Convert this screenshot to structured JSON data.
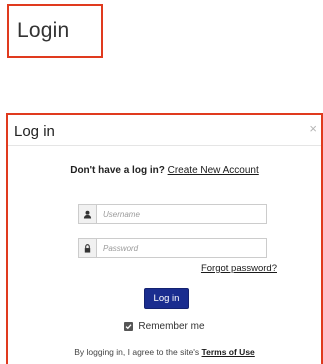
{
  "top_link": {
    "label": "Login"
  },
  "modal": {
    "title": "Log in",
    "close_glyph": "×",
    "signup_prompt": "Don't have a log in?",
    "signup_link": "Create New Account",
    "username_placeholder": "Username",
    "password_placeholder": "Password",
    "forgot_link": "Forgot password?",
    "login_button": "Log in",
    "remember_label": "Remember me",
    "remember_checked": true,
    "terms_prefix": "By logging in, I agree to the site's",
    "terms_link": "Terms of Use"
  },
  "colors": {
    "highlight_border": "#e03a1e",
    "primary_button": "#1a2d8f"
  },
  "icons": {
    "username": "user-icon",
    "password": "lock-icon",
    "remember": "checkbox-icon",
    "close": "close-icon"
  }
}
